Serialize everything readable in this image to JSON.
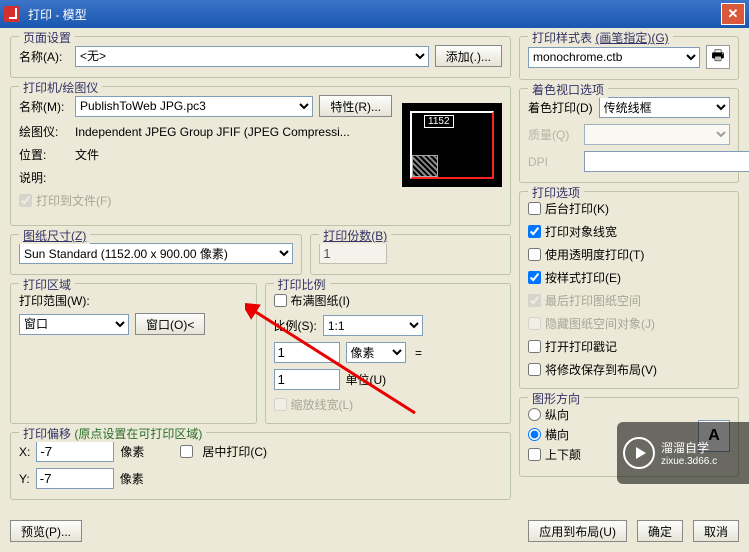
{
  "title": "打印 - 模型",
  "page_setup": {
    "legend": "页面设置",
    "name_lab": "名称(A):",
    "name_val": "<无>",
    "add_btn": "添加(.)..."
  },
  "printer": {
    "legend": "打印机/绘图仪",
    "name_lab": "名称(M):",
    "name_val": "PublishToWeb JPG.pc3",
    "props_btn": "特性(R)...",
    "plotter_lab": "绘图仪:",
    "plotter_val": "Independent JPEG Group JFIF (JPEG Compressi...",
    "loc_lab": "位置:",
    "loc_val": "文件",
    "desc_lab": "说明:",
    "to_file": "打印到文件(F)",
    "preview_dim": "1152"
  },
  "paper": {
    "legend": "图纸尺寸(Z)",
    "value": "Sun Standard (1152.00 x 900.00 像素)"
  },
  "copies": {
    "legend": "打印份数(B)",
    "value": "1"
  },
  "area": {
    "legend": "打印区域",
    "range_lab": "打印范围(W):",
    "range_val": "窗口",
    "window_btn": "窗口(O)<"
  },
  "scale": {
    "legend": "打印比例",
    "fit": "布满图纸(I)",
    "scale_lab": "比例(S):",
    "scale_val": "1:1",
    "unit1": "1",
    "unit1_lab": "像素",
    "eq": "=",
    "unit2": "1",
    "unit2_lab": "单位(U)",
    "line_scale": "缩放线宽(L)"
  },
  "offset": {
    "legend_a": "打印偏移",
    "legend_b": "(原点设置在可打印区域)",
    "x_lab": "X:",
    "x_val": "-7",
    "y_lab": "Y:",
    "y_val": "-7",
    "unit": "像素",
    "center": "居中打印(C)"
  },
  "styles": {
    "legend_a": "打印样式表",
    "legend_b": "(画笔指定)(G)",
    "value": "monochrome.ctb"
  },
  "viewport": {
    "legend": "着色视口选项",
    "shade_lab": "着色打印(D)",
    "shade_val": "传统线框",
    "quality_lab": "质量(Q)",
    "dpi_lab": "DPI"
  },
  "options": {
    "legend": "打印选项",
    "o1": "后台打印(K)",
    "o2": "打印对象线宽",
    "o3": "使用透明度打印(T)",
    "o4": "按样式打印(E)",
    "o5": "最后打印图纸空间",
    "o6": "隐藏图纸空间对象(J)",
    "o7": "打开打印戳记",
    "o8": "将修改保存到布局(V)"
  },
  "orient": {
    "legend": "图形方向",
    "portrait": "纵向",
    "landscape": "横向",
    "upside": "上下颠",
    "sample": "A"
  },
  "buttons": {
    "preview": "预览(P)...",
    "apply": "应用到布局(U)",
    "ok": "确定",
    "cancel": "取消"
  },
  "watermark": {
    "line1": "溜溜自学",
    "line2": "zixue.3d66.c"
  }
}
